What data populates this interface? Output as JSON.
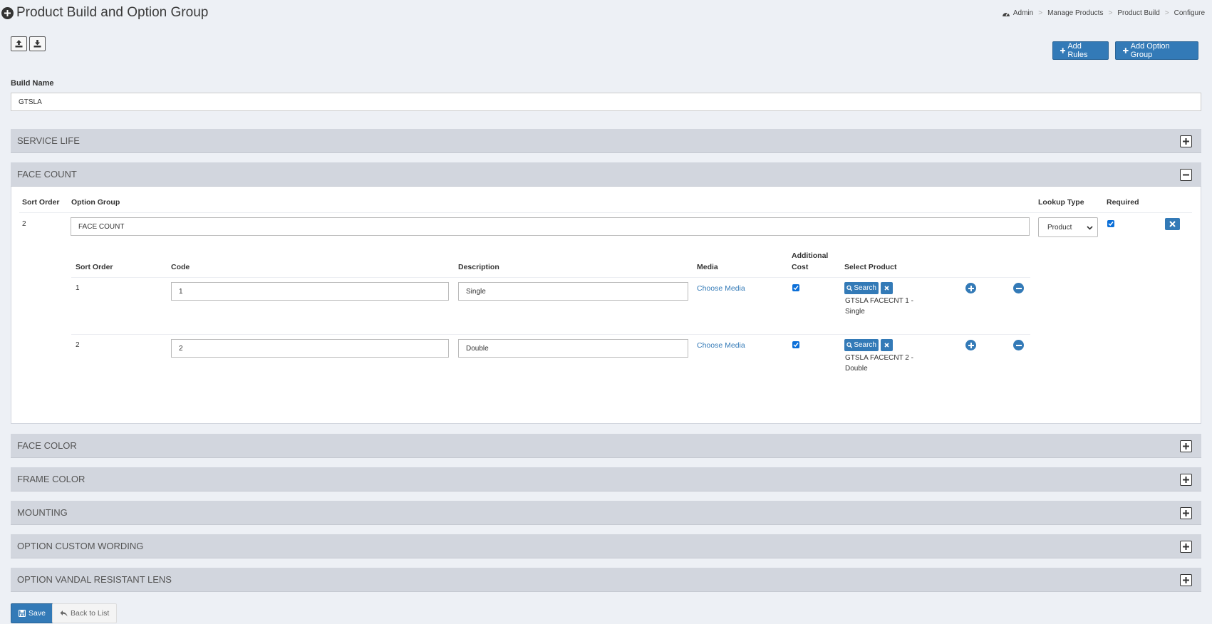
{
  "header": {
    "title": "Product Build and Option Group",
    "breadcrumb": [
      "Admin",
      "Manage Products",
      "Product Build",
      "Configure"
    ]
  },
  "toolbar": {
    "add_rules": "Add Rules",
    "add_option_group": "Add Option Group"
  },
  "build": {
    "label": "Build Name",
    "value": "GTSLA"
  },
  "panels": [
    {
      "title": "SERVICE LIFE",
      "expanded": false
    },
    {
      "title": "FACE COUNT",
      "expanded": true
    },
    {
      "title": "FACE COLOR",
      "expanded": false
    },
    {
      "title": "FRAME COLOR",
      "expanded": false
    },
    {
      "title": "MOUNTING",
      "expanded": false
    },
    {
      "title": "OPTION CUSTOM WORDING",
      "expanded": false
    },
    {
      "title": "OPTION VANDAL RESISTANT LENS",
      "expanded": false
    }
  ],
  "group": {
    "headers": {
      "sort_order": "Sort Order",
      "option_group": "Option Group",
      "lookup_type": "Lookup Type",
      "required": "Required"
    },
    "sort_order": "2",
    "option_group": "FACE COUNT",
    "lookup_type": "Product",
    "required": true
  },
  "options_table": {
    "headers": {
      "sort_order": "Sort Order",
      "code": "Code",
      "description": "Description",
      "media": "Media",
      "additional_cost_1": "Additional",
      "additional_cost_2": "Cost",
      "select_product": "Select Product"
    },
    "search_label": "Search",
    "rows": [
      {
        "sort_order": "1",
        "code": "1",
        "description": "Single",
        "media": "Choose Media",
        "additional_cost": true,
        "product_1": "GTSLA FACECNT 1 -",
        "product_2": "Single"
      },
      {
        "sort_order": "2",
        "code": "2",
        "description": "Double",
        "media": "Choose Media",
        "additional_cost": true,
        "product_1": "GTSLA FACECNT 2 -",
        "product_2": "Double"
      }
    ]
  },
  "footer": {
    "save": "Save",
    "back": "Back to List"
  },
  "colors": {
    "primary": "#337ab7",
    "panel_header": "#d2d6de",
    "background": "#edf0f5"
  }
}
